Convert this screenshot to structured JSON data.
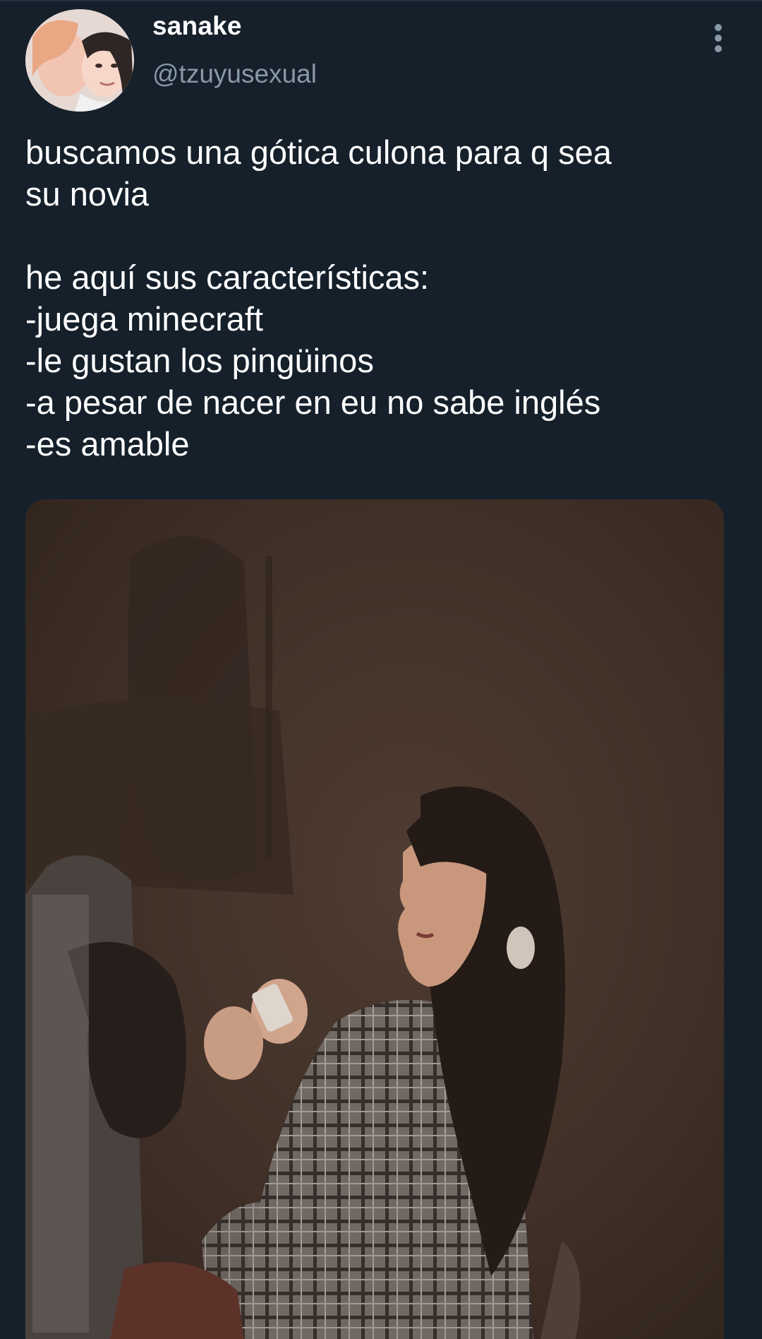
{
  "tweet": {
    "display_name": "sanake",
    "handle": "@tzuyusexual",
    "text": "buscamos una gótica culona para q sea\nsu novia\n\nhe aquí sus características:\n-juega minecraft\n-le gustan los pingüinos\n-a pesar de nacer en eu no sabe inglés\n-es amable"
  },
  "icons": {
    "avatar": "profile-photo",
    "more": "more-vertical-icon"
  },
  "colors": {
    "background": "#15202b",
    "primary_text": "#ffffff",
    "secondary_text": "#8899a6"
  }
}
